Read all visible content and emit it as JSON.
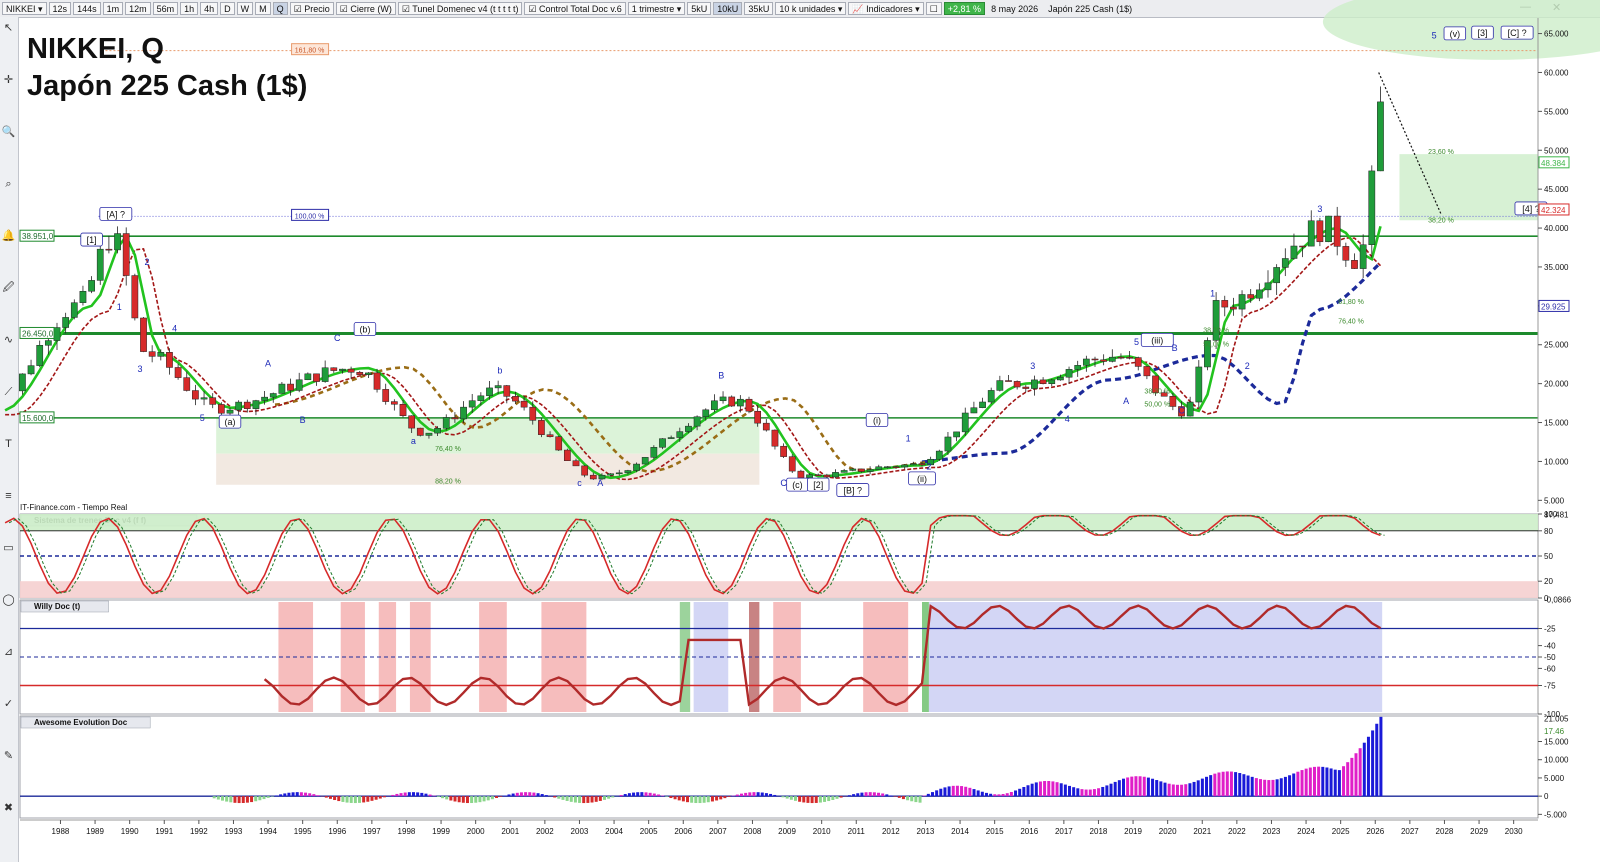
{
  "toolbar": {
    "symbol": "NIKKEI",
    "timeframes": [
      "12s",
      "144s",
      "1m",
      "12m",
      "56m",
      "1h",
      "4h",
      "D",
      "W",
      "M",
      "Q"
    ],
    "selected_timeframe": "Q",
    "indicator_tabs": [
      "Precio",
      "Cierre (W)",
      "Tunel Domenec v4 (t t t t t)",
      "Control Total Doc v.6"
    ],
    "period": "1 trimestre",
    "units": [
      "5kU",
      "10kU",
      "35kU"
    ],
    "selected_unit": "10kU",
    "units_dropdown": "10 k unidades",
    "indicators_label": "Indicadores",
    "change_pct": "+2,81 %",
    "date": "8 may 2026",
    "instrument": "Japón 225 Cash (1$)"
  },
  "chart_data": [
    {
      "type": "candlestick",
      "title": "NIKKEI, Q",
      "subtitle": "Japón 225 Cash (1$)",
      "source": "IT-Finance.com - Tiempo Real",
      "x_ticks": [
        "1988",
        "1989",
        "1990",
        "1991",
        "1992",
        "1993",
        "1994",
        "1995",
        "1996",
        "1997",
        "1998",
        "1999",
        "2000",
        "2001",
        "2002",
        "2003",
        "2004",
        "2005",
        "2006",
        "2007",
        "2008",
        "2009",
        "2010",
        "2011",
        "2012",
        "2013",
        "2014",
        "2015",
        "2016",
        "2017",
        "2018",
        "2019",
        "2020",
        "2021",
        "2022",
        "2023",
        "2024",
        "2025",
        "2026",
        "2027",
        "2028",
        "2029",
        "2030"
      ],
      "y_ticks": [
        "5.000",
        "10.000",
        "15.000",
        "20.000",
        "25.000",
        "30.000",
        "35.000",
        "40.000",
        "45.000",
        "50.000",
        "55.000",
        "60.000",
        "65.000"
      ],
      "ylim": [
        3500,
        67000
      ],
      "price_tags_left": [
        "38.951,0",
        "26.450,0",
        "15.600,0"
      ],
      "price_tags_right": [
        "48.384",
        "42.324",
        "29.925"
      ],
      "key_quarterly_closes": [
        {
          "x": "1988",
          "close": 30000
        },
        {
          "x": "1989",
          "close": 38900
        },
        {
          "x": "1990",
          "close": 23800
        },
        {
          "x": "1992",
          "close": 16900
        },
        {
          "x": "1996",
          "close": 22000
        },
        {
          "x": "1998",
          "close": 13800
        },
        {
          "x": "2000",
          "close": 19000
        },
        {
          "x": "2003",
          "close": 7900
        },
        {
          "x": "2007",
          "close": 17800
        },
        {
          "x": "2009",
          "close": 8100
        },
        {
          "x": "2012",
          "close": 9500
        },
        {
          "x": "2015",
          "close": 20000
        },
        {
          "x": "2018",
          "close": 23500
        },
        {
          "x": "2020",
          "close": 16500
        },
        {
          "x": "2021",
          "close": 30000
        },
        {
          "x": "2024",
          "close": 40000
        },
        {
          "x": "2025",
          "close": 36000
        },
        {
          "x": "2026",
          "close": 63000
        }
      ],
      "horizontal_levels": [
        38951,
        26450,
        15600
      ],
      "fib_labels": [
        "161,80 %",
        "100,00 %",
        "23,60 %",
        "38,20 %",
        "76,40 %",
        "88,20 %",
        "38,20 %",
        "50,00 %",
        "61,80 %",
        "38,20 %",
        "50,00 %",
        "76,40 %"
      ],
      "wave_labels": [
        "[1]",
        "[A] ?",
        "1",
        "2",
        "3",
        "4",
        "5",
        "(a)",
        "A",
        "B",
        "C",
        "(b)",
        "a",
        "b",
        "c",
        "A",
        "B",
        "C",
        "(c)",
        "[2]",
        "[B] ?",
        "(i)",
        "(ii)",
        "1",
        "2",
        "3",
        "4",
        "5",
        "(iii)",
        "A",
        "B",
        "C",
        "1",
        "2",
        "3",
        "5",
        "(v)",
        "[3]",
        "[C] ?",
        "[4] ?"
      ]
    },
    {
      "type": "line",
      "title": "Sistema de trenes Doc v4 (f f)",
      "y_ticks": [
        "100",
        "80",
        "50",
        "20",
        "0"
      ],
      "ylim": [
        0,
        100
      ],
      "last_value": "87,481"
    },
    {
      "type": "line",
      "title": "Willy Doc (t)",
      "y_ticks": [
        "-25",
        "-40",
        "-50",
        "-60",
        "-75",
        "-100"
      ],
      "ylim": [
        -100,
        0
      ],
      "last_value": "-0,0866"
    },
    {
      "type": "bar",
      "title": "Awesome Evolution Doc",
      "y_ticks": [
        "15.000",
        "10.000",
        "5.000",
        "0",
        "-5.000"
      ],
      "ylim": [
        -6000,
        22000
      ],
      "last_values": [
        "21.005",
        "17.46"
      ]
    }
  ],
  "colors": {
    "bull_candle": "#1f9c3a",
    "bear_candle": "#d62a2a",
    "support_line": "#1d8a2c",
    "fast_ma": "#22c31f",
    "slow_ma": "#a31717",
    "long_ma": "#1c2a9a",
    "mid_ma": "#9a6d16",
    "bull_zone": "#cdeec9",
    "bear_zone": "#f5cfcf"
  }
}
